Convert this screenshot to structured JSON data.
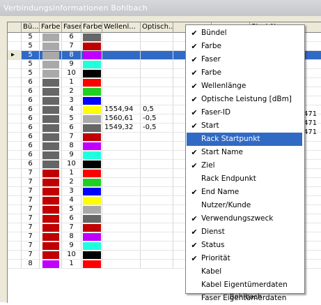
{
  "window": {
    "title": "Verbindungsinformationen Bohlbach"
  },
  "columns": [
    "Bü...",
    "Farbe",
    "Faser",
    "Farbe",
    "Wellenl...",
    "Optisch...",
    "",
    "",
    "Start Name"
  ],
  "colors": {
    "gray": "#a9a9a9",
    "dark": "#666666",
    "red": "#ff0000",
    "maroon": "#c00000",
    "magenta": "#c000ff",
    "cyan": "#20ffdd",
    "black": "#000000",
    "green": "#20d020",
    "blue": "#0000ff",
    "yellow": "#ffff00"
  },
  "rows": [
    {
      "b": "5",
      "c1": "gray",
      "f": "6",
      "c2": "dark",
      "w": "",
      "o": ""
    },
    {
      "b": "5",
      "c1": "gray",
      "f": "7",
      "c2": "maroon",
      "w": "",
      "o": ""
    },
    {
      "b": "5",
      "c1": "gray",
      "f": "8",
      "c2": "magenta",
      "w": "",
      "o": "",
      "selected": true
    },
    {
      "b": "5",
      "c1": "gray",
      "f": "9",
      "c2": "cyan",
      "w": "",
      "o": ""
    },
    {
      "b": "5",
      "c1": "gray",
      "f": "10",
      "c2": "black",
      "w": "",
      "o": ""
    },
    {
      "b": "6",
      "c1": "dark",
      "f": "1",
      "c2": "red",
      "w": "",
      "o": ""
    },
    {
      "b": "6",
      "c1": "dark",
      "f": "2",
      "c2": "green",
      "w": "",
      "o": ""
    },
    {
      "b": "6",
      "c1": "dark",
      "f": "3",
      "c2": "blue",
      "w": "",
      "o": ""
    },
    {
      "b": "6",
      "c1": "dark",
      "f": "4",
      "c2": "yellow",
      "w": "1554,94",
      "o": "0,5"
    },
    {
      "b": "6",
      "c1": "dark",
      "f": "5",
      "c2": "gray",
      "w": "1560,61",
      "o": "-0,5"
    },
    {
      "b": "6",
      "c1": "dark",
      "f": "6",
      "c2": "dark",
      "w": "1549,32",
      "o": "-0,5"
    },
    {
      "b": "6",
      "c1": "dark",
      "f": "7",
      "c2": "maroon",
      "w": "",
      "o": ""
    },
    {
      "b": "6",
      "c1": "dark",
      "f": "8",
      "c2": "magenta",
      "w": "",
      "o": ""
    },
    {
      "b": "6",
      "c1": "dark",
      "f": "9",
      "c2": "cyan",
      "w": "",
      "o": ""
    },
    {
      "b": "6",
      "c1": "dark",
      "f": "10",
      "c2": "black",
      "w": "",
      "o": ""
    },
    {
      "b": "7",
      "c1": "maroon",
      "f": "1",
      "c2": "red",
      "w": "",
      "o": ""
    },
    {
      "b": "7",
      "c1": "maroon",
      "f": "2",
      "c2": "green",
      "w": "",
      "o": ""
    },
    {
      "b": "7",
      "c1": "maroon",
      "f": "3",
      "c2": "blue",
      "w": "",
      "o": ""
    },
    {
      "b": "7",
      "c1": "maroon",
      "f": "4",
      "c2": "yellow",
      "w": "",
      "o": ""
    },
    {
      "b": "7",
      "c1": "maroon",
      "f": "5",
      "c2": "gray",
      "w": "",
      "o": ""
    },
    {
      "b": "7",
      "c1": "maroon",
      "f": "6",
      "c2": "dark",
      "w": "",
      "o": ""
    },
    {
      "b": "7",
      "c1": "maroon",
      "f": "7",
      "c2": "maroon",
      "w": "",
      "o": ""
    },
    {
      "b": "7",
      "c1": "maroon",
      "f": "8",
      "c2": "magenta",
      "w": "",
      "o": ""
    },
    {
      "b": "7",
      "c1": "maroon",
      "f": "9",
      "c2": "cyan",
      "w": "",
      "o": ""
    },
    {
      "b": "7",
      "c1": "maroon",
      "f": "10",
      "c2": "black",
      "w": "",
      "o": ""
    },
    {
      "b": "8",
      "c1": "magenta",
      "f": "1",
      "c2": "red",
      "w": "",
      "o": ""
    }
  ],
  "right_clip": [
    "471",
    "471",
    "471"
  ],
  "menu": {
    "items": [
      {
        "label": "Bündel",
        "checked": true
      },
      {
        "label": "Farbe",
        "checked": true
      },
      {
        "label": "Faser",
        "checked": true
      },
      {
        "label": "Farbe",
        "checked": true
      },
      {
        "label": "Wellenlänge",
        "checked": true
      },
      {
        "label": "Optische Leistung [dBm]",
        "checked": true
      },
      {
        "label": "Faser-ID",
        "checked": true
      },
      {
        "label": "Start",
        "checked": true
      },
      {
        "label": "Rack Startpunkt",
        "checked": false,
        "highlighted": true
      },
      {
        "label": "Start Name",
        "checked": true
      },
      {
        "label": "Ziel",
        "checked": true
      },
      {
        "label": "Rack Endpunkt",
        "checked": false
      },
      {
        "label": "End Name",
        "checked": true
      },
      {
        "label": "Nutzer/Kunde",
        "checked": false
      },
      {
        "label": "Verwendungszweck",
        "checked": true
      },
      {
        "label": "Dienst",
        "checked": true
      },
      {
        "label": "Status",
        "checked": true
      },
      {
        "label": "Priorität",
        "checked": true
      },
      {
        "label": "Kabel",
        "checked": false
      },
      {
        "label": "Kabel  Eigentümerdaten",
        "checked": false
      },
      {
        "label": "Faser Eigentümerdaten",
        "checked": false
      }
    ],
    "check_glyph": "✔"
  },
  "bottom_cell": "Bohlbach"
}
